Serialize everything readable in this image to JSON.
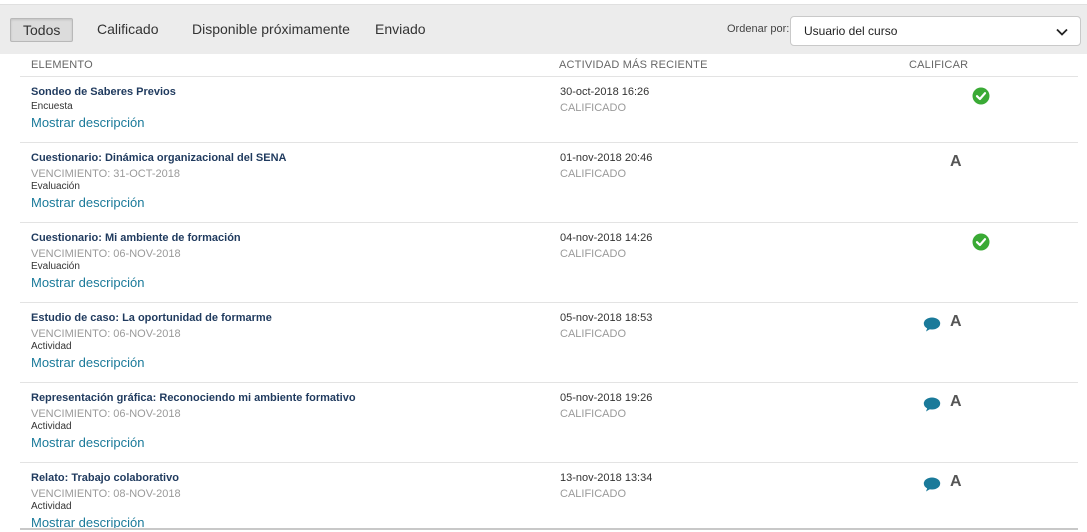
{
  "filters": {
    "tabs": [
      "Todos",
      "Calificado",
      "Disponible próximamente",
      "Enviado"
    ],
    "active": "Todos"
  },
  "sort": {
    "label": "Ordenar por:",
    "value": "Usuario del curso"
  },
  "columns": {
    "item": "ELEMENTO",
    "activity": "ACTIVIDAD MÁS RECIENTE",
    "grade": "CALIFICAR"
  },
  "rows": [
    {
      "title": "Sondeo de Saberes Previos",
      "due": "",
      "type": "Encuesta",
      "link": "Mostrar descripción",
      "date": "30-oct-2018 16:26",
      "status": "CALIFICADO",
      "grade": "",
      "icon": "check-circle-icon",
      "has_comment": false
    },
    {
      "title": "Cuestionario: Dinámica organizacional del SENA",
      "due": "VENCIMIENTO: 31-OCT-2018",
      "type": "Evaluación",
      "link": "Mostrar descripción",
      "date": "01-nov-2018 20:46",
      "status": "CALIFICADO",
      "grade": "A",
      "icon": "",
      "has_comment": false
    },
    {
      "title": "Cuestionario: Mi ambiente de formación",
      "due": "VENCIMIENTO: 06-NOV-2018",
      "type": "Evaluación",
      "link": "Mostrar descripción",
      "date": "04-nov-2018 14:26",
      "status": "CALIFICADO",
      "grade": "",
      "icon": "check-circle-icon",
      "has_comment": false
    },
    {
      "title": "Estudio de caso: La oportunidad de formarme",
      "due": "VENCIMIENTO: 06-NOV-2018",
      "type": "Actividad",
      "link": "Mostrar descripción",
      "date": "05-nov-2018 18:53",
      "status": "CALIFICADO",
      "grade": "A",
      "icon": "comment-icon",
      "has_comment": true
    },
    {
      "title": "Representación gráfica: Reconociendo mi ambiente formativo",
      "due": "VENCIMIENTO: 06-NOV-2018",
      "type": "Actividad",
      "link": "Mostrar descripción",
      "date": "05-nov-2018 19:26",
      "status": "CALIFICADO",
      "grade": "A",
      "icon": "comment-icon",
      "has_comment": true
    },
    {
      "title": "Relato: Trabajo colaborativo",
      "due": "VENCIMIENTO: 08-NOV-2018",
      "type": "Actividad",
      "link": "Mostrar descripción",
      "date": "13-nov-2018 13:34",
      "status": "CALIFICADO",
      "grade": "A",
      "icon": "comment-icon",
      "has_comment": true
    }
  ],
  "colors": {
    "check": "#3aaa35",
    "comment": "#1a7a9a",
    "title": "#1f3a5e",
    "link": "#1a7a9a"
  }
}
